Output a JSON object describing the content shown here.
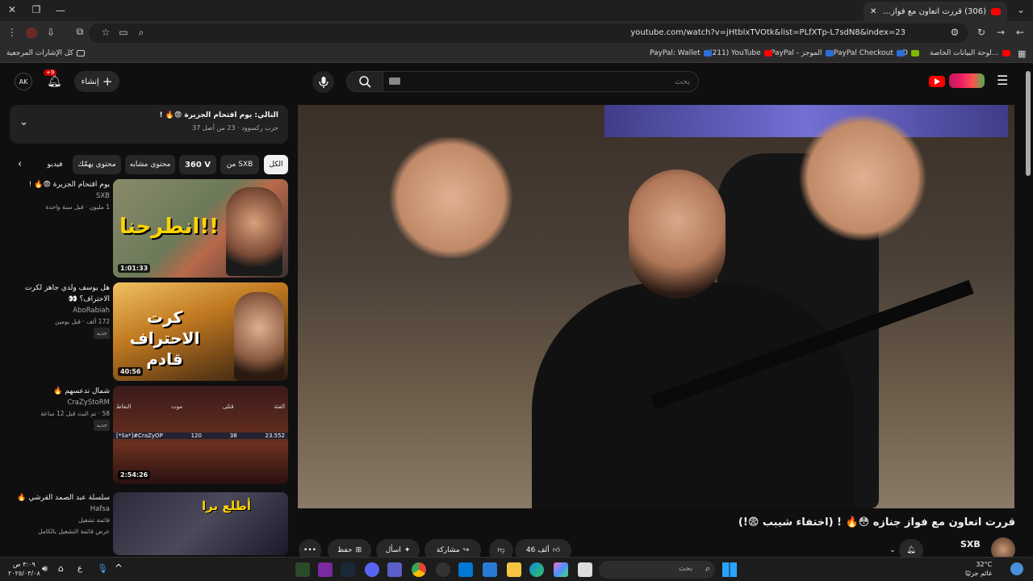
{
  "browser": {
    "tab_title": "(306) قررت اتعاون مع فواز جنازه",
    "url": "youtube.com/watch?v=jHtblxTVOtk&list=PLfXTp-L7sdN8&index=23",
    "bookmarks": {
      "all_bookmarks": "كل الإشارات المرجعية",
      "items": [
        "لوحة البيانات الخاصة...",
        "D",
        "PayPal Checkout",
        "PayPal - الموجز",
        "(211) YouTube",
        "PayPal: Wallet"
      ]
    }
  },
  "header": {
    "search_placeholder": "بحث",
    "create_label": "إنشاء",
    "notif_count": "+9",
    "avatar_initials": "AK"
  },
  "playlist": {
    "title": "التالي: يوم اقتحام الجزيرة 😨🔥 !",
    "subtitle": "حزب ركسوود · 23 من أصل 37"
  },
  "chips": [
    "الكل",
    "من SXB",
    "360 V",
    "محتوى مشابه",
    "محتوى يهمّك",
    "فيديو"
  ],
  "recommendations": [
    {
      "title": "يوم اقتحام الجزيرة 😨🔥 !",
      "channel": "SXB",
      "stats": "1 مليون · قبل سنة واحدة",
      "badge": "",
      "duration": "1:01:33",
      "thumb_text": "انطرحنا!!"
    },
    {
      "title": "هل يوسف ولدي جاهز لكرت الاحتراف؟ 👀",
      "channel": "AboRabiah",
      "stats": "172 ألف · قبل يومين",
      "badge": "جديد",
      "duration": "40:56",
      "thumb_text": "كرت الاحتراف قادم"
    },
    {
      "title": "شمال ندعسهم 🔥",
      "channel": "CraZyStoRM",
      "stats": "58 · تم البث قبل 12 ساعة",
      "badge": "جديد",
      "duration": "2:54:26",
      "thumb_text": ""
    },
    {
      "title": "سلسلة عبد الصمد القرشي 🔥",
      "channel": "Hafsa",
      "stats": "قائمة تشغيل",
      "badge": "عرض قائمة التشغيل بالكامل",
      "duration": "",
      "thumb_text": "أطلع برا"
    }
  ],
  "scoreboard": {
    "headers": [
      "النقاط",
      "موت",
      "قتلى",
      "الفئة"
    ],
    "row": [
      "23.552",
      "38",
      "120",
      "[*Sa*]#CraZyOP"
    ]
  },
  "video": {
    "title": "قررت اتعاون مع فواز جنازه 😳🔥 ! (اختفاء شيبب 😨!)",
    "channel": "SXB",
    "like_count": "46 ألف",
    "share_label": "مشاركة",
    "ask_label": "اسأل",
    "save_label": "حفظ"
  },
  "taskbar": {
    "search_placeholder": "بحث",
    "weather_temp": "32°C",
    "weather_desc": "غائم جزئيًا",
    "time": "٣:٠٩ ص",
    "date": "٢٠٢٥/٠٣/٠٨",
    "lang": "ع"
  },
  "colors": {
    "brand": "#ff0000",
    "bg": "#0f0f0f",
    "surface": "#272727"
  }
}
